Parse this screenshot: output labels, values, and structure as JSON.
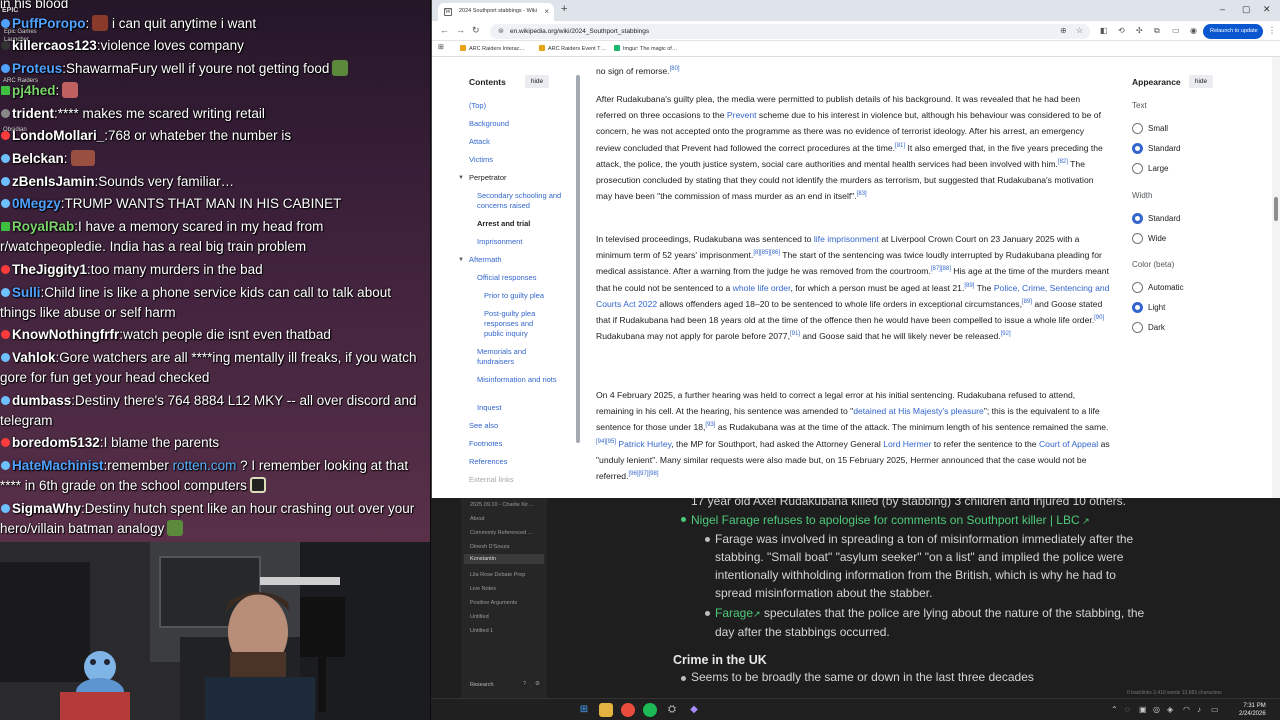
{
  "chat": {
    "top_fragment": "in his blood",
    "side_labels": [
      "EPIC",
      "Epic Games",
      "Launcher",
      "ARC Raiders",
      "Obsidian"
    ],
    "messages": [
      {
        "user": "PuffPoropo",
        "text": "i can quit anytime i want",
        "user_color": "#4fa3ff",
        "badge_color": "#4fa3ff"
      },
      {
        "user": "killercaos123",
        "text": "violence loves company",
        "user_color": "#ffffff",
        "badge_color": "#333333"
      },
      {
        "user": "Proteus",
        "text": "ShawarmaFury well if youre not getting food",
        "user_color": "#4fa3ff",
        "badge_color": "#4fa3ff"
      },
      {
        "user": "pj4hed",
        "text": "",
        "user_color": "#7bd36b",
        "badge_color": "#3fbf3f"
      },
      {
        "user": "trident",
        "text": "**** makes me scared writing retail",
        "user_color": "#ffffff",
        "badge_color": "#888888"
      },
      {
        "user": "LondoMollari_",
        "text": "768 or whateber the number is",
        "user_color": "#ffffff",
        "badge_color": "#ff3b3b"
      },
      {
        "user": "Belckan",
        "text": "",
        "user_color": "#ffffff",
        "badge_color": "#6ec1ff"
      },
      {
        "user": "zBenIsJamin",
        "text": "Sounds very familiar…",
        "user_color": "#ffffff",
        "badge_color": "#6ec1ff"
      },
      {
        "user": "0Megzy",
        "text": "TRUMP WANTS THAT MAN IN HIS CABINET",
        "user_color": "#4fa3ff",
        "badge_color": "#6ec1ff"
      },
      {
        "user": "RoyalRab",
        "text": "I have a memory scared in my head from r/watchpeopledie. India has a real big train problem",
        "user_color": "#7bd36b",
        "badge_color": "#3fbf3f"
      },
      {
        "user": "TheJiggity1",
        "text": "too many murders in the bad",
        "user_color": "#ffffff",
        "badge_color": "#ff3b3b"
      },
      {
        "user": "Sulli",
        "text": "Child line is like a phone service kids can call to talk about things like abuse or self harm",
        "user_color": "#4fa3ff",
        "badge_color": "#6ec1ff"
      },
      {
        "user": "KnowNothingfrfr",
        "text": "watch people die isnt even thatbad",
        "user_color": "#ffffff",
        "badge_color": "#ff3b3b"
      },
      {
        "user": "Vahlok",
        "text": "Gore watchers are all ****ing mentally ill freaks, if you watch gore for fun get your head checked",
        "user_color": "#ffffff",
        "badge_color": "#6ec1ff"
      },
      {
        "user": "dumbass",
        "text": "Destiny there's 764 8884 L12 MKY -- all over discord and telegram",
        "user_color": "#ffffff",
        "badge_color": "#6ec1ff"
      },
      {
        "user": "boredom5132",
        "text": "I blame the parents",
        "user_color": "#ffffff",
        "badge_color": "#ff3b3b"
      },
      {
        "user": "HateMachinist",
        "text_before": "remember ",
        "link": "rotten.com",
        "text": " ? I remember looking at that **** in 6th grade on the school computers",
        "user_color": "#4fa3ff",
        "badge_color": "#6ec1ff"
      },
      {
        "user": "SigmaWhy",
        "text": "Destiny hutch spent like an hour crashing out over your hero/villain batman analogy",
        "user_color": "#ffffff",
        "badge_color": "#6ec1ff"
      }
    ]
  },
  "browser": {
    "tab_title": "2024 Southport stabbings - Wiki",
    "url": "en.wikipedia.org/wiki/2024_Southport_stabbings",
    "relaunch_label": "Relaunch to update",
    "bookmarks": [
      "ARC Raiders Interac…",
      "ARC Raiders Event T…",
      "Imgur: The magic of…"
    ]
  },
  "toc": {
    "title": "Contents",
    "hide_label": "hide",
    "items": [
      {
        "label": "(Top)",
        "level": 0
      },
      {
        "label": "Background",
        "level": 0
      },
      {
        "label": "Attack",
        "level": 0
      },
      {
        "label": "Victims",
        "level": 0
      },
      {
        "label": "Perpetrator",
        "level": 0,
        "expanded": true
      },
      {
        "label": "Secondary schooling and concerns raised",
        "level": 1
      },
      {
        "label": "Arrest and trial",
        "level": 1,
        "active": true
      },
      {
        "label": "Imprisonment",
        "level": 1
      },
      {
        "label": "Aftermath",
        "level": 0,
        "expanded": true
      },
      {
        "label": "Official responses",
        "level": 1
      },
      {
        "label": "Prior to guilty plea",
        "level": 2
      },
      {
        "label": "Post-guilty plea responses and public inquiry",
        "level": 2
      },
      {
        "label": "Memorials and fundraisers",
        "level": 1
      },
      {
        "label": "Misinformation and riots",
        "level": 1
      },
      {
        "label": "Inquest",
        "level": 1
      },
      {
        "label": "See also",
        "level": 0
      },
      {
        "label": "Footnotes",
        "level": 0
      },
      {
        "label": "References",
        "level": 0
      },
      {
        "label": "External links",
        "level": 0,
        "muted": true
      }
    ]
  },
  "article": {
    "p0": {
      "text": "no sign of remorse.",
      "ref": "[80]"
    },
    "p1": {
      "a": "After Rudakubana's guilty plea, the media were permitted to publish details of his background. It was revealed that he had been referred on three occasions to the ",
      "link1": "Prevent",
      "b": " scheme due to his interest in violence but, although his behaviour was considered to be of concern, he was not accepted onto the programme as there was no evidence of terrorist ideology. After his arrest, an emergency review concluded that Prevent had followed the correct procedures at the time.",
      "ref1": "[81]",
      "c": " It also emerged that, in the five years preceding the attack, the police, the youth justice system, social care authorities and mental health services had been involved with him.",
      "ref2": "[82]",
      "d": " The prosecution concluded by stating that they could not identify the murders as terrorism, but suggested that Rudakubana's motivation may have been \"the commission of mass murder as an end in itself\".",
      "ref3": "[83]"
    },
    "p2": {
      "a": "In televised proceedings, Rudakubana was sentenced to ",
      "link1": "life imprisonment",
      "b": " at Liverpool Crown Court on 23 January 2025 with a minimum term of 52 years' imprisonment.",
      "ref1": "[8][85][86]",
      "c": " The start of the sentencing was twice loudly interrupted by Rudakubana pleading for medical assistance. After a warning from the judge he was removed from the courtroom.",
      "ref2": "[87][88]",
      "d": " His age at the time of the murders meant that he could not be sentenced to a ",
      "link2": "whole life order",
      "e": ", for which a person must be aged at least 21.",
      "ref3": "[89]",
      "f": " The ",
      "link3": "Police, Crime, Sentencing and Courts Act 2022",
      "g": " allows offenders aged 18–20 to be sentenced to whole life orders in exceptional circumstances,",
      "ref4": "[89]",
      "h": " and Goose stated that if Rudakubana had been 18 years old at the time of the offence then he would have been compelled to issue a whole life order.",
      "ref5": "[90]",
      "i": " Rudakubana may not apply for parole before 2077,",
      "ref6": "[91]",
      "j": " and Goose said that he will likely never be released.",
      "ref7": "[92]"
    },
    "p3": {
      "a": "On 4 February 2025, a further hearing was held to correct a legal error at his initial sentencing. Rudakubana refused to attend, remaining in his cell. At the hearing, his sentence was amended to \"",
      "link1": "detained at His Majesty's pleasure",
      "b": "\"; this is the equivalent to a life sentence for those under 18,",
      "ref1": "[93]",
      "c": " as Rudakubana was at the time of the attack. The minimum length of his sentence remained the same.",
      "ref2": "[94][95]",
      "d": " ",
      "link2": "Patrick Hurley",
      "e": ", the MP for Southport, had asked the Attorney General ",
      "link3": "Lord Hermer",
      "f": " to refer the sentence to the ",
      "link4": "Court of Appeal",
      "g": " as \"unduly lenient\". Many similar requests were also made but, on 15 February 2025, Hermer announced that the case would not be referred.",
      "ref3": "[96][97][98]"
    }
  },
  "appearance": {
    "title": "Appearance",
    "hide_label": "hide",
    "groups": [
      {
        "label": "Text",
        "options": [
          "Small",
          "Standard",
          "Large"
        ],
        "selected": 1
      },
      {
        "label": "Width",
        "options": [
          "Standard",
          "Wide"
        ],
        "selected": 0
      },
      {
        "label": "Color (beta)",
        "options": [
          "Automatic",
          "Light",
          "Dark"
        ],
        "selected": 1
      }
    ]
  },
  "notes": {
    "sidebar_items": [
      "2025.09.10 - Charlie Kir…",
      "About",
      "Commonly Referenced …",
      "Dinesh D'Souza",
      "Konstantin",
      "Lila Rose Debate Prep",
      "Live Notes",
      "Positive Arguments",
      "Untitled",
      "Untitled 1"
    ],
    "sidebar_selected": 4,
    "footer_label": "Research",
    "line0": "17 year old Axel Rudakubana killed (by stabbing) 3 children and injured 10 others.",
    "link1": "Nigel Farage refuses to apologise for comments on Southport killer | LBC",
    "sub1": "Farage was involved in spreading a ton of misinformation immediately after the stabbing. \"Small boat\" \"asylum seeker\" \"on a list\" and implied the police were intentionally withholding information from the British, which is why he had to spread misinformation about the stabber.",
    "link2": "Farage",
    "sub2": " speculates that the police are lying about the nature of the stabbing, the day after the stabbings occurred.",
    "heading": "Crime in the UK",
    "line_last": "Seems to be broadly the same or down in the last three decades",
    "status": "0 backlinks   2,410 words 13,683 characters"
  },
  "taskbar": {
    "time": "7:31 PM",
    "date": "2/24/2026"
  }
}
